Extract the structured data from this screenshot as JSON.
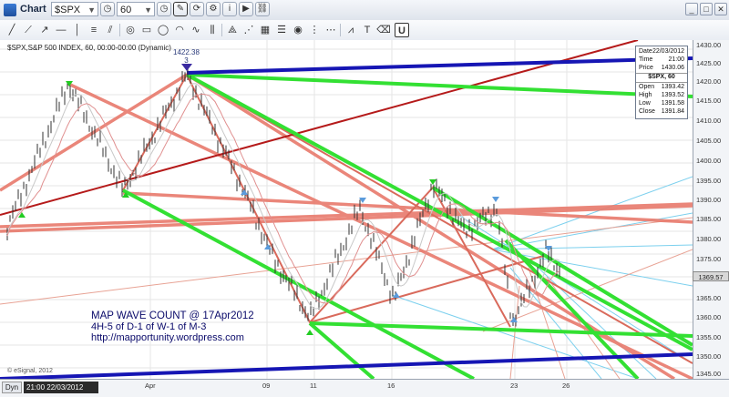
{
  "window": {
    "title": "Chart"
  },
  "header_bar": {
    "symbol_value": "$SPX",
    "interval_value": "60"
  },
  "chart": {
    "header_text": "$SPX,S&P 500 INDEX, 60, 00:00-00:00 (Dynamic)",
    "peak_value": "1422.38",
    "peak_label": "3",
    "watermark": "© eSignal, 2012",
    "annotation_line1": "MAP WAVE COUNT @ 17Apr2012",
    "annotation_line2": "4H-5 of D-1 of  W-1 of M-3",
    "annotation_line3": "http://mapportunity.wordpress.com",
    "colors": {
      "green": "#22dd22",
      "salmon": "#e8786a",
      "blue": "#1818b0",
      "darkred": "#b01515",
      "cyan": "#66c8e8",
      "price": "#333333"
    }
  },
  "info_box": {
    "date_label": "Date",
    "date_value": "22/03/2012",
    "time_label": "Time",
    "time_value": "21:00",
    "price_label": "Price",
    "price_value": "1430.06",
    "symbol_line": "$SPX, 60",
    "open_label": "Open",
    "open_value": "1393.42",
    "high_label": "High",
    "high_value": "1393.52",
    "low_label": "Low",
    "low_value": "1391.58",
    "close_label": "Close",
    "close_value": "1391.84"
  },
  "price_axis": {
    "labels": [
      "1430.00",
      "1425.00",
      "1420.00",
      "1415.00",
      "1410.00",
      "1405.00",
      "1400.00",
      "1395.00",
      "1390.00",
      "1385.00",
      "1380.00",
      "1375.00",
      "1365.00",
      "1360.00",
      "1355.00",
      "1350.00",
      "1345.00"
    ],
    "last_price": "1369.57"
  },
  "date_axis": {
    "dyn_label": "Dyn",
    "cursor_text": "21:00 22/03/2012",
    "labels": [
      "Apr",
      "09",
      "11",
      "16",
      "23",
      "26"
    ]
  }
}
